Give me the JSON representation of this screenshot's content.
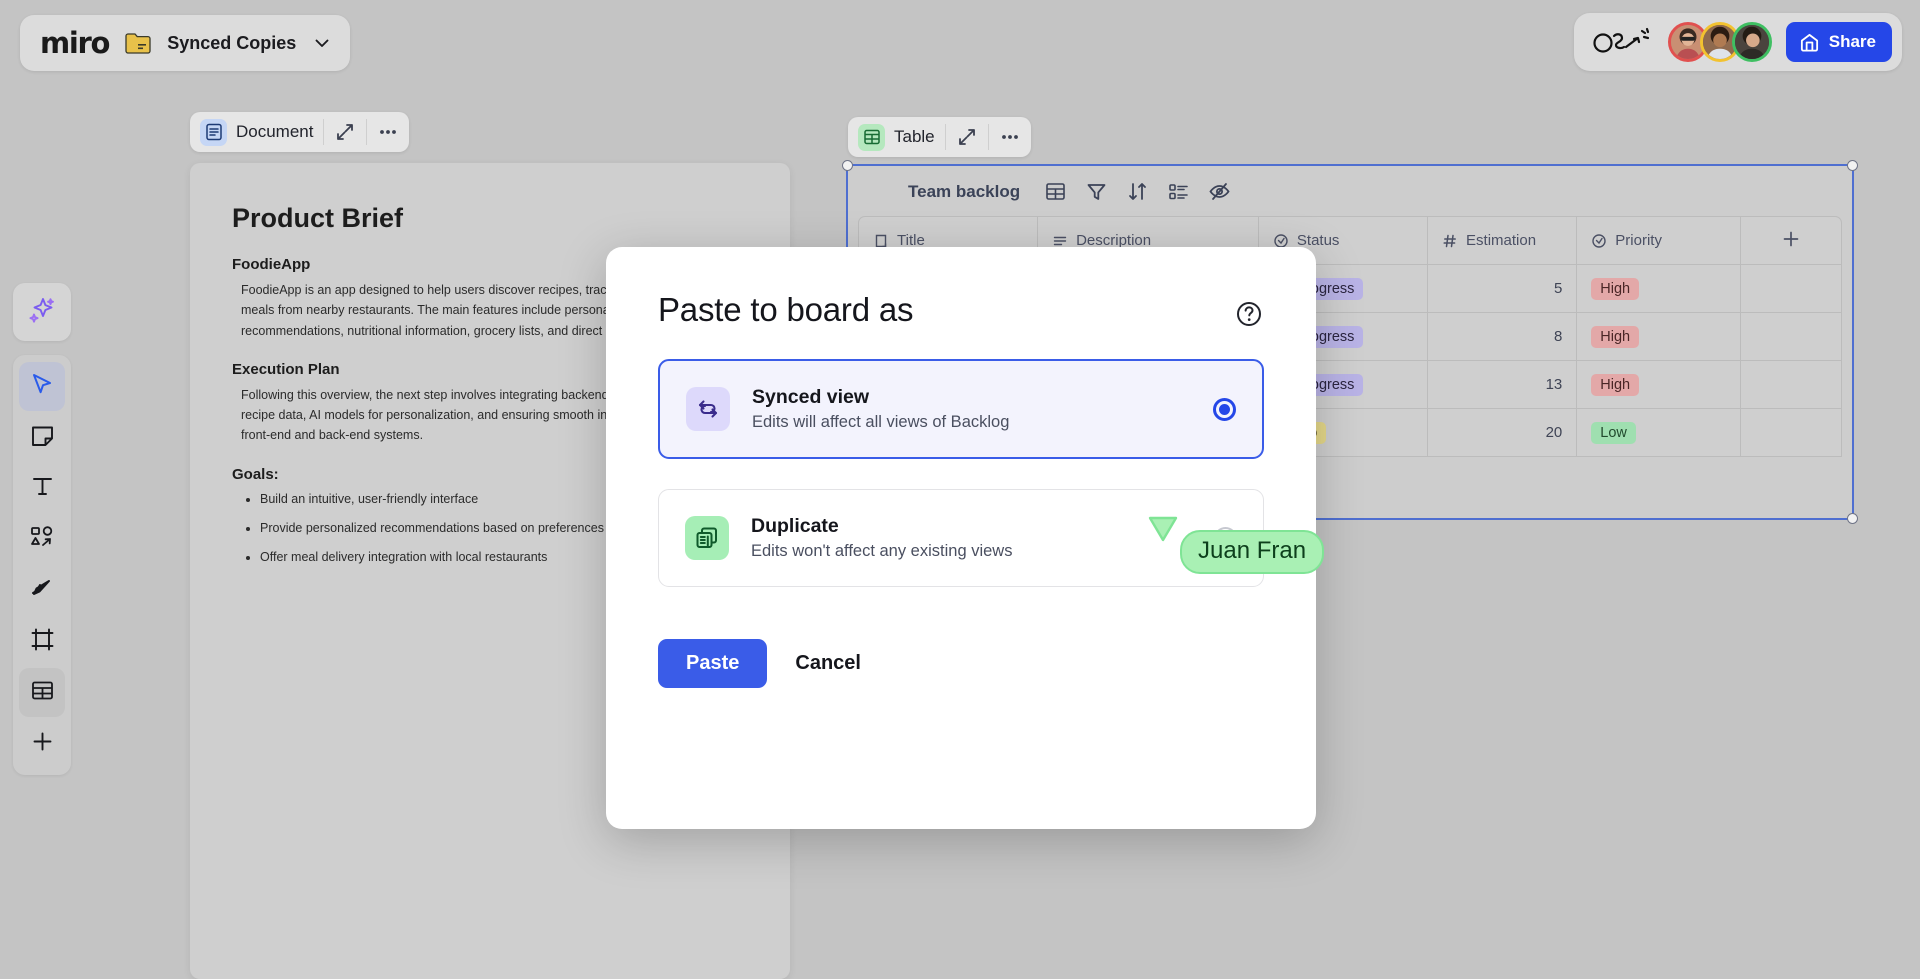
{
  "app": {
    "logo_text": "miro",
    "board_name": "Synced Copies",
    "folder_icon": "folder-icon",
    "chevron_icon": "chevron-down-icon"
  },
  "topbar_right": {
    "scribble_icon": "scribble-annotation-icon",
    "collaborators": [
      {
        "name": "collaborator-1",
        "ring_color": "#e1504f"
      },
      {
        "name": "collaborator-2",
        "ring_color": "#f2c230"
      },
      {
        "name": "collaborator-3",
        "ring_color": "#3fbf62"
      }
    ],
    "share_label": "Share",
    "share_icon": "share-board-icon",
    "share_color": "#2547e8"
  },
  "toolbar": {
    "items": [
      {
        "name": "ai-sparkle-tool",
        "icon": "sparkle-icon",
        "active": false
      },
      {
        "name": "select-tool",
        "icon": "cursor-arrow-icon",
        "active": true
      },
      {
        "name": "sticky-note-tool",
        "icon": "sticky-note-icon",
        "active": false
      },
      {
        "name": "text-tool",
        "icon": "text-t-icon",
        "active": false
      },
      {
        "name": "shapes-tool",
        "icon": "shapes-icon",
        "active": false
      },
      {
        "name": "pen-tool",
        "icon": "pen-icon",
        "active": false
      },
      {
        "name": "frame-tool",
        "icon": "frame-icon",
        "active": false
      },
      {
        "name": "table-tool",
        "icon": "table-grid-icon",
        "active": true
      },
      {
        "name": "more-apps-tool",
        "icon": "plus-icon",
        "active": false
      }
    ]
  },
  "document_widget": {
    "badge_icon": "document-icon",
    "label": "Document",
    "expand_icon": "expand-icon",
    "more_icon": "more-dots-icon",
    "title": "Product Brief",
    "sections": [
      {
        "heading": "FoodieApp",
        "body": "FoodieApp is an app designed to help users discover recipes, track nutrition, and order meals from nearby restaurants. The main features include personalized meal recommendations, nutritional information, grocery lists, and direct delivery integration."
      },
      {
        "heading": "Execution Plan",
        "body": "Following this overview, the next step involves integrating backend code for managing recipe data, AI models for personalization, and ensuring smooth interactions across the front-end and back-end systems."
      }
    ],
    "goals_heading": "Goals:",
    "goals": [
      "Build an intuitive, user-friendly interface",
      "Provide personalized recommendations based on preferences and diet",
      "Offer meal delivery integration with local restaurants"
    ]
  },
  "table_widget": {
    "badge_icon": "table-grid-icon",
    "label": "Table",
    "expand_icon": "expand-icon",
    "more_icon": "more-dots-icon",
    "view_name": "Team backlog",
    "view_actions": [
      {
        "name": "table-view-icon",
        "icon": "table-grid-icon"
      },
      {
        "name": "filter-icon",
        "icon": "funnel-icon"
      },
      {
        "name": "sort-icon",
        "icon": "sort-arrows-icon"
      },
      {
        "name": "group-icon",
        "icon": "group-list-icon"
      },
      {
        "name": "hide-fields-icon",
        "icon": "eye-off-icon"
      }
    ],
    "columns": [
      {
        "label": "Title",
        "icon": "text-field-icon"
      },
      {
        "label": "Description",
        "icon": "long-text-icon"
      },
      {
        "label": "Status",
        "icon": "single-select-icon"
      },
      {
        "label": "Estimation",
        "icon": "number-hash-icon"
      },
      {
        "label": "Priority",
        "icon": "single-select-icon"
      },
      {
        "label": "",
        "icon": "plus-icon"
      }
    ],
    "rows": [
      {
        "title": "",
        "description": "",
        "status": "In progress",
        "status_style": "inprog",
        "estimation": "5",
        "priority": "High",
        "priority_style": "high"
      },
      {
        "title": "",
        "description": "",
        "status": "In progress",
        "status_style": "inprog",
        "estimation": "8",
        "priority": "High",
        "priority_style": "high"
      },
      {
        "title": "",
        "description": "",
        "status": "In progress",
        "status_style": "inprog",
        "estimation": "13",
        "priority": "High",
        "priority_style": "high"
      },
      {
        "title": "",
        "description": "",
        "status": "To do",
        "status_style": "todo",
        "estimation": "20",
        "priority": "Low",
        "priority_style": "low"
      }
    ]
  },
  "remote_cursor": {
    "name": "Juan Fran",
    "color": "#a9f0b4"
  },
  "modal": {
    "title": "Paste to board as",
    "help_icon": "help-question-icon",
    "options": [
      {
        "id": "synced-view",
        "name": "Synced view",
        "description": "Edits will affect all views of Backlog",
        "icon": "sync-arrows-icon",
        "selected": true
      },
      {
        "id": "duplicate",
        "name": "Duplicate",
        "description": "Edits won't affect any existing views",
        "icon": "duplicate-copies-icon",
        "selected": false
      }
    ],
    "primary_label": "Paste",
    "secondary_label": "Cancel",
    "primary_color": "#3a5ce8"
  }
}
